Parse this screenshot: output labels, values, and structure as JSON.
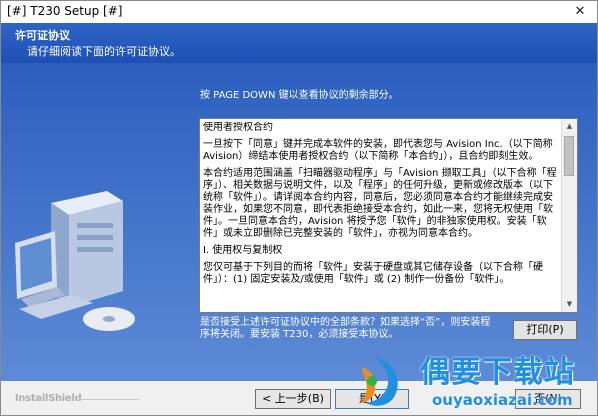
{
  "window": {
    "title": "[#] T230 Setup [#]",
    "close_glyph": "✕"
  },
  "header": {
    "title": "许可证协议",
    "subtitle": "请仔细阅读下面的许可证协议。"
  },
  "instruction": "按 PAGE DOWN 键以查看协议的剩余部分。",
  "license": {
    "paragraphs": [
      "使用者授权合约",
      "一旦按下「同意」键并完成本软件的安装，即代表您与 Avision Inc.（以下简称 Avision）缔结本使用者授权合约（以下简称「本合约」），且合约即刻生效。",
      "本合约适用范围涵盖「扫瞄器驱动程序」与「Avision 撷取工具」（以下合称「程序」）、相关数据与说明文件，以及「程序」的任何升级，更新或修改版本（以下统称「软件」）。请详阅本合约内容，同意后，您必须同意本合约才能继续完成安装作业，如果您不同意，即代表拒绝接受本合约，如此一来，您将无权使用「软件」。一旦同意本合约，Avision 将授予您「软件」的非独家使用权。安装「软件」或未立即删除已完整安装的「软件」，亦视为同意本合约。",
      "I. 使用权与复制权",
      "您仅可基于下列目的而将「软件」安装于硬盘或其它储存设备（以下合称「硬件」）：(1) 固定安装及/或使用「软件」或 (2) 制作一份备份「软件」。"
    ]
  },
  "scrollbar": {
    "up_glyph": "▲",
    "down_glyph": "▼"
  },
  "question": "是否接受上述许可证协议中的全部条款？如果选择“否”，则安装程序将关闭。要安装 T230，必须接受本协议。",
  "buttons": {
    "print": "打印(P)",
    "back": "< 上一步(B)",
    "yes": "是(Y)",
    "no": "否(N)"
  },
  "brand": "InstallShield",
  "watermark": {
    "cn": "偶要下载站",
    "en": "ouyaoxiazai.com"
  }
}
